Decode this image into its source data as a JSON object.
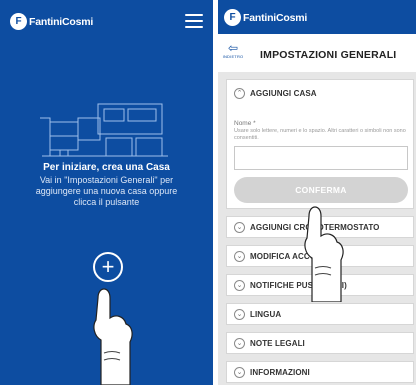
{
  "left_screen": {
    "logo_text": "FantiniCosmi",
    "heading": "Per iniziare, crea una Casa",
    "body": "Vai in \"Impostazioni Generali\" per aggiungere una nuova casa oppure clicca il pulsante",
    "add_button_glyph": "+"
  },
  "right_screen": {
    "logo_text": "FantiniCosmi",
    "back_label": "INDIETRO",
    "title": "IMPOSTAZIONI GENERALI",
    "add_home": {
      "label": "AGGIUNGI CASA",
      "field_label": "Nome *",
      "field_hint": "Usare solo lettere, numeri e lo spazio. Altri caratteri o simboli non sono consentiti.",
      "field_value": "",
      "confirm_label": "CONFERMA"
    },
    "menu": [
      {
        "label": "AGGIUNGI CRONOTERMOSTATO"
      },
      {
        "label": "MODIFICA ACCOUNT"
      },
      {
        "label": "NOTIFICHE PUSH (WI-FI)"
      },
      {
        "label": "LINGUA"
      },
      {
        "label": "NOTE LEGALI"
      },
      {
        "label": "INFORMAZIONI"
      }
    ]
  },
  "colors": {
    "brand_blue": "#0d4da1",
    "background_grey": "#e6e6e6",
    "disabled_button": "#d3d3d3"
  },
  "icons": [
    "logo-icon",
    "menu-icon",
    "house-illustration",
    "plus-icon",
    "back-arrow-icon",
    "chevron-down-icon",
    "pointing-hand-icon"
  ]
}
